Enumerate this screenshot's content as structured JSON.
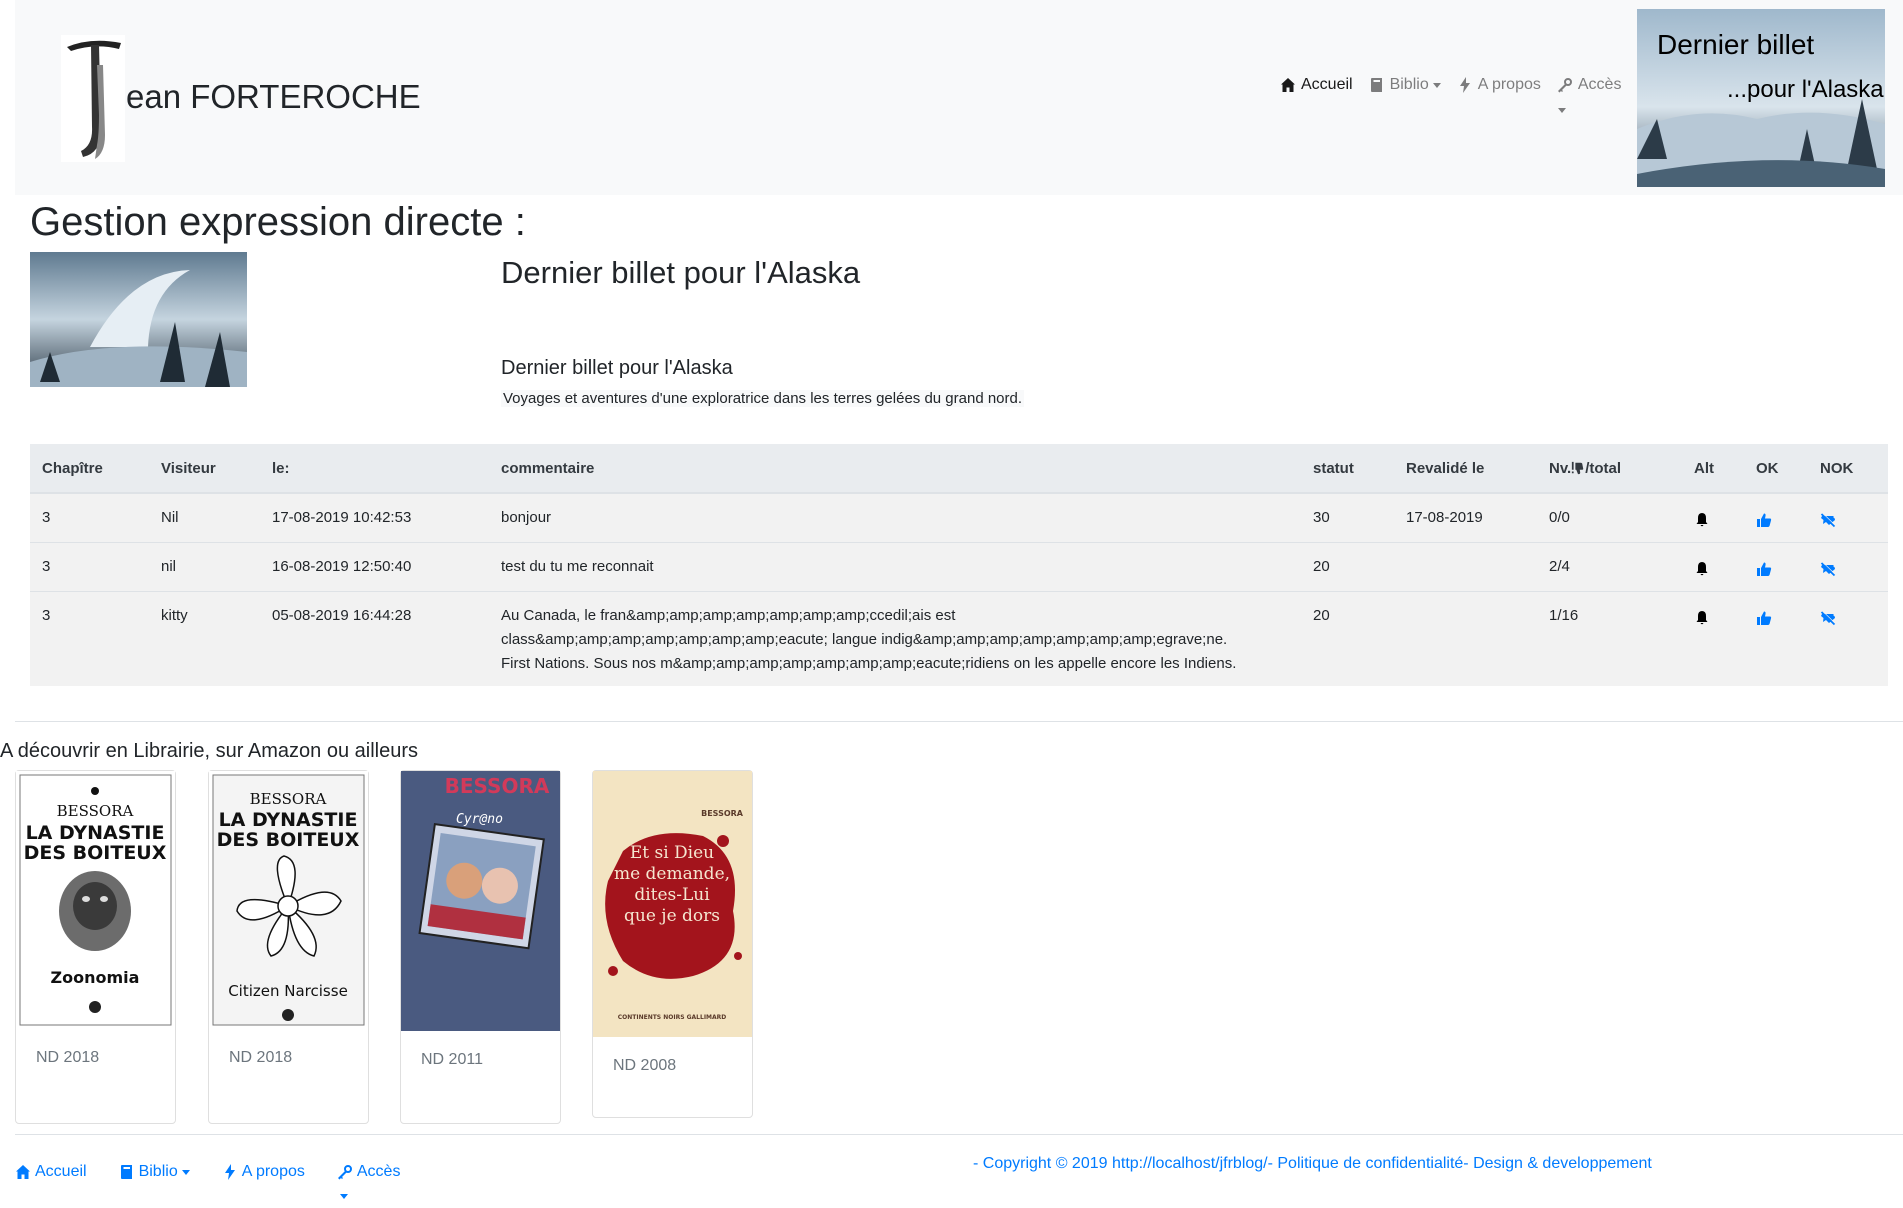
{
  "header": {
    "brand": "ean FORTEROCHE",
    "nav": {
      "accueil": "Accueil",
      "biblio": "Biblio",
      "apropos": "A propos",
      "acces": "Accès"
    },
    "banner": {
      "line1": "Dernier billet",
      "line2": "...pour l'Alaska"
    }
  },
  "page": {
    "title": "Gestion expression directe :",
    "book_title": "Dernier billet pour l'Alaska",
    "book_subtitle": "Dernier billet pour l'Alaska",
    "book_description": "Voyages et aventures d'une exploratrice dans les terres gelées du grand nord."
  },
  "table": {
    "headers": {
      "chapitre": "Chapître",
      "visiteur": "Visiteur",
      "le": "le:",
      "commentaire": "commentaire",
      "statut": "statut",
      "revalide": "Revalidé le",
      "nv_prefix": "Nv.",
      "nv_suffix": "/total",
      "alt": "Alt",
      "ok": "OK",
      "nok": "NOK"
    },
    "rows": [
      {
        "chapitre": "3",
        "visiteur": "Nil",
        "le": "17-08-2019 10:42:53",
        "commentaire_lines": [
          "bonjour"
        ],
        "statut": "30",
        "revalide": "17-08-2019",
        "ratio": "0/0"
      },
      {
        "chapitre": "3",
        "visiteur": "nil",
        "le": "16-08-2019 12:50:40",
        "commentaire_lines": [
          "test du tu me reconnait"
        ],
        "statut": "20",
        "revalide": "",
        "ratio": "2/4"
      },
      {
        "chapitre": "3",
        "visiteur": "kitty",
        "le": "05-08-2019 16:44:28",
        "commentaire_lines": [
          "Au Canada, le fran&amp;amp;amp;amp;amp;amp;amp;ccedil;ais est",
          "class&amp;amp;amp;amp;amp;amp;amp;eacute; langue indig&amp;amp;amp;amp;amp;amp;amp;egrave;ne.",
          "First Nations. Sous nos m&amp;amp;amp;amp;amp;amp;amp;eacute;ridiens on les appelle encore les Indiens."
        ],
        "statut": "20",
        "revalide": "",
        "ratio": "1/16"
      }
    ]
  },
  "books_section": {
    "heading": "A découvrir en Librairie, sur Amazon ou ailleurs",
    "books": [
      {
        "author": "BESSORA",
        "title_line1": "LA DYNASTIE",
        "title_line2": "DES BOITEUX",
        "subtitle": "Zoonomia",
        "date": "ND 2018"
      },
      {
        "author": "BESSORA",
        "title_line1": "LA DYNASTIE",
        "title_line2": "DES BOITEUX",
        "subtitle": "Citizen Narcisse",
        "date": "ND 2018"
      },
      {
        "author": "BESSORA",
        "subtitle": "Cyr@no",
        "date": "ND 2011"
      },
      {
        "author": "BESSORA",
        "title_lines": [
          "Et si Dieu",
          "me demande,",
          "dites-Lui",
          "que je dors"
        ],
        "publisher": "CONTINENTS NOIRS  GALLIMARD",
        "date": "ND 2008"
      }
    ]
  },
  "footer": {
    "nav": {
      "accueil": "Accueil",
      "biblio": "Biblio",
      "apropos": "A propos",
      "acces": "Accès"
    },
    "copyright": "- Copyright © 2019 http://localhost/jfrblog/- Politique de confidentialité- Design & developpement"
  },
  "colors": {
    "link": "#007bff",
    "navbar_bg": "#f8f9fa",
    "table_head_bg": "#e9ecef"
  }
}
